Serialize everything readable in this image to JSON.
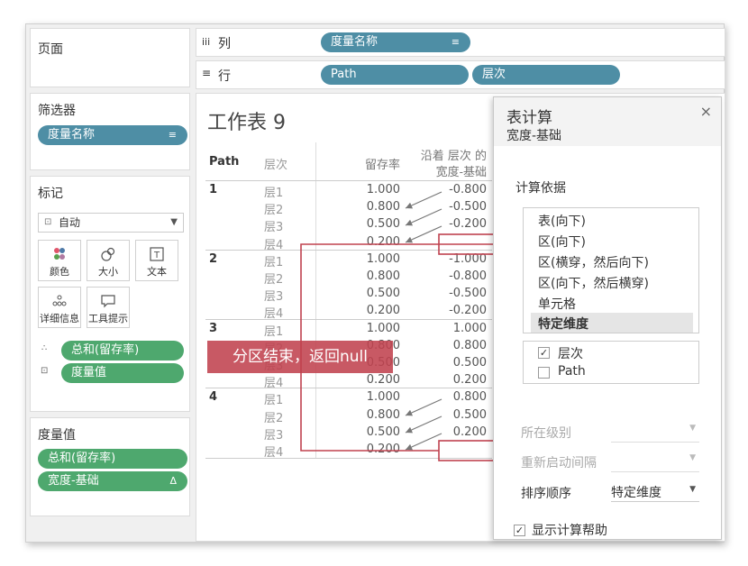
{
  "pages_panel": {
    "title": "页面"
  },
  "filters_panel": {
    "title": "筛选器",
    "pill": "度量名称"
  },
  "marks_panel": {
    "title": "标记",
    "type_select": "自动",
    "cards": [
      "颜色",
      "大小",
      "文本",
      "详细信息",
      "工具提示"
    ],
    "fields": [
      "总和(留存率)",
      "度量值"
    ]
  },
  "measures_panel": {
    "title": "度量值",
    "pills": [
      "总和(留存率)",
      "宽度-基础"
    ]
  },
  "shelves": {
    "columns_label": "列",
    "columns_pill": "度量名称",
    "rows_label": "行",
    "rows_pills": [
      "Path",
      "层次"
    ]
  },
  "sheet": {
    "title": "工作表 9",
    "headers": {
      "path": "Path",
      "level": "层次",
      "rate": "留存率",
      "calc_line1": "沿着 层次 的",
      "calc_line2": "宽度-基础"
    },
    "groups": [
      {
        "path": "1",
        "rows": [
          {
            "level": "层1",
            "rate": "1.000",
            "calc": "-0.800"
          },
          {
            "level": "层2",
            "rate": "0.800",
            "calc": "-0.500"
          },
          {
            "level": "层3",
            "rate": "0.500",
            "calc": "-0.200"
          },
          {
            "level": "层4",
            "rate": "0.200",
            "calc": ""
          }
        ]
      },
      {
        "path": "2",
        "rows": [
          {
            "level": "层1",
            "rate": "1.000",
            "calc": "-1.000"
          },
          {
            "level": "层2",
            "rate": "0.800",
            "calc": "-0.800"
          },
          {
            "level": "层3",
            "rate": "0.500",
            "calc": "-0.500"
          },
          {
            "level": "层4",
            "rate": "0.200",
            "calc": "-0.200"
          }
        ]
      },
      {
        "path": "3",
        "rows": [
          {
            "level": "层1",
            "rate": "1.000",
            "calc": "1.000"
          },
          {
            "level": "层2",
            "rate": "0.800",
            "calc": "0.800"
          },
          {
            "level": "层3",
            "rate": "0.500",
            "calc": "0.500"
          },
          {
            "level": "层4",
            "rate": "0.200",
            "calc": "0.200"
          }
        ]
      },
      {
        "path": "4",
        "rows": [
          {
            "level": "层1",
            "rate": "1.000",
            "calc": "0.800"
          },
          {
            "level": "层2",
            "rate": "0.800",
            "calc": "0.500"
          },
          {
            "level": "层3",
            "rate": "0.500",
            "calc": "0.200"
          },
          {
            "level": "层4",
            "rate": "0.200",
            "calc": ""
          }
        ]
      }
    ],
    "annotation": "分区结束，返回null",
    "annotation_color": "#c0424f"
  },
  "table_calc": {
    "title": "表计算",
    "subtitle": "宽度-基础",
    "compute_using_label": "计算依据",
    "options": [
      "表(向下)",
      "区(向下)",
      "区(横穿，然后向下)",
      "区(向下，然后横穿)",
      "单元格",
      "特定维度"
    ],
    "selected_option": "特定维度",
    "dimensions": [
      {
        "label": "层次",
        "checked": true
      },
      {
        "label": "Path",
        "checked": false
      }
    ],
    "at_level_label": "所在级别",
    "restart_label": "重新启动间隔",
    "sort_label": "排序顺序",
    "sort_value": "特定维度",
    "show_help_label": "显示计算帮助",
    "show_help_checked": true
  },
  "colors": {
    "blue_pill": "#4e8ea5",
    "green_pill": "#4ea86e",
    "highlight": "#c0424f"
  }
}
